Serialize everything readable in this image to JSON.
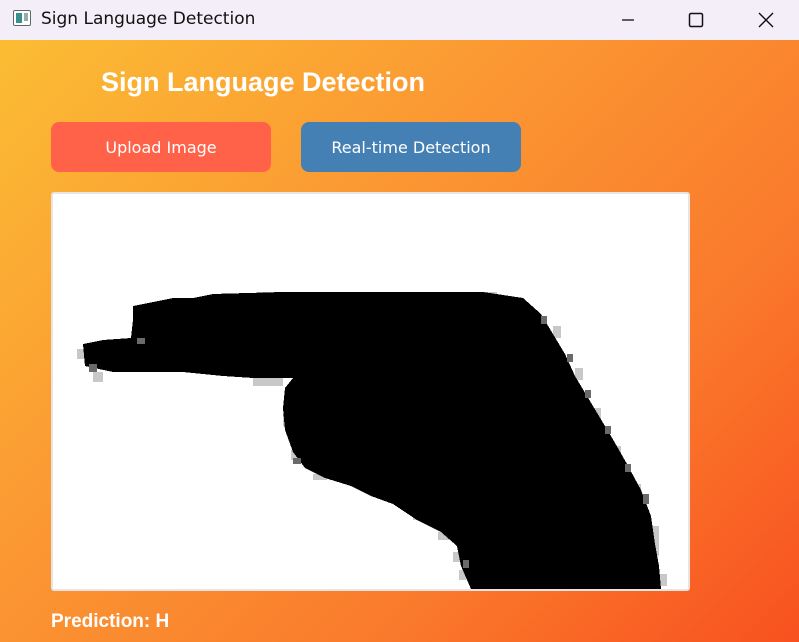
{
  "window": {
    "title": "Sign Language Detection",
    "icons": {
      "app": "app-icon",
      "minimize": "minimize-icon",
      "maximize": "maximize-icon",
      "close": "close-icon"
    }
  },
  "main": {
    "heading": "Sign Language Detection",
    "upload_button": "Upload Image",
    "realtime_button": "Real-time Detection",
    "image": {
      "description_icon": "hand-sign-image"
    },
    "prediction_label": "Prediction: H"
  },
  "colors": {
    "titlebar": "#f3eef8",
    "gradient_start": "#fbbd33",
    "gradient_end": "#f8511f",
    "upload_button": "#ff6248",
    "realtime_button": "#4580b4",
    "text": "#ffffff"
  }
}
